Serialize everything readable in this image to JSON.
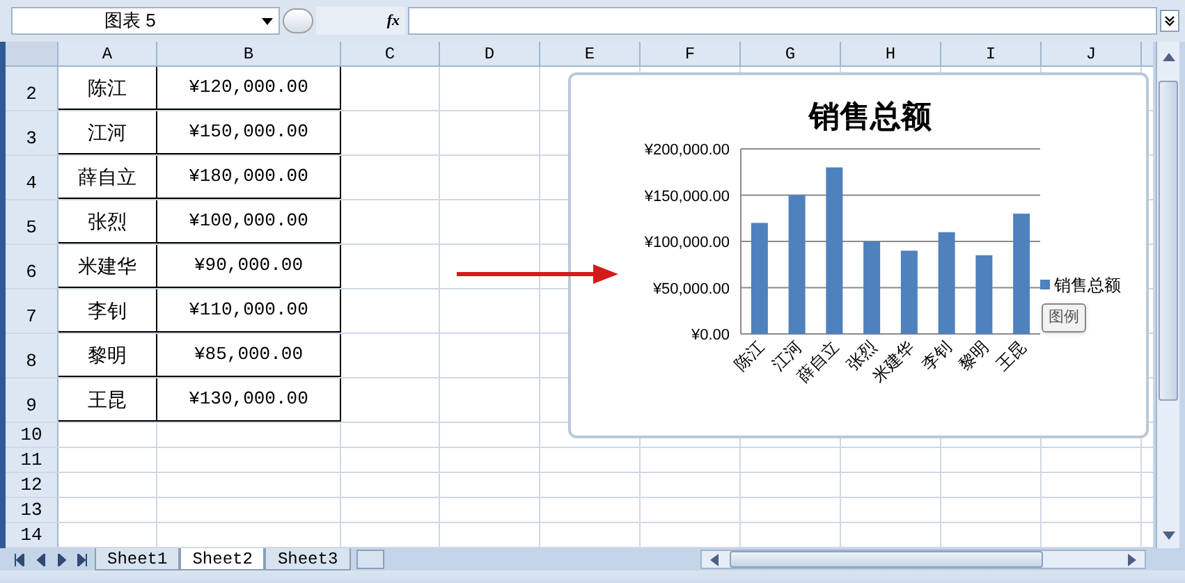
{
  "formula_bar": {
    "name_box": "图表 5",
    "fx_label": "fx"
  },
  "columns": [
    "A",
    "B",
    "C",
    "D",
    "E",
    "F",
    "G",
    "H",
    "I",
    "J"
  ],
  "rows": [
    {
      "number": "2",
      "name": "陈江",
      "amount": "¥120,000.00"
    },
    {
      "number": "3",
      "name": "江河",
      "amount": "¥150,000.00"
    },
    {
      "number": "4",
      "name": "薛自立",
      "amount": "¥180,000.00"
    },
    {
      "number": "5",
      "name": "张烈",
      "amount": "¥100,000.00"
    },
    {
      "number": "6",
      "name": "米建华",
      "amount": "¥90,000.00"
    },
    {
      "number": "7",
      "name": "李钊",
      "amount": "¥110,000.00"
    },
    {
      "number": "8",
      "name": "黎明",
      "amount": "¥85,000.00"
    },
    {
      "number": "9",
      "name": "王昆",
      "amount": "¥130,000.00"
    }
  ],
  "empty_rows": [
    "10",
    "11",
    "12",
    "13",
    "14"
  ],
  "sheet_tabs": [
    {
      "label": "Sheet1",
      "selected": false
    },
    {
      "label": "Sheet2",
      "selected": true
    },
    {
      "label": "Sheet3",
      "selected": false
    }
  ],
  "chart": {
    "tooltip": "图例",
    "chart_data": {
      "type": "bar",
      "title": "销售总额",
      "categories": [
        "陈江",
        "江河",
        "薛自立",
        "张烈",
        "米建华",
        "李钊",
        "黎明",
        "王昆"
      ],
      "series": [
        {
          "name": "销售总额",
          "color": "#4f81bd",
          "values": [
            120000,
            150000,
            180000,
            100000,
            90000,
            110000,
            85000,
            130000
          ]
        }
      ],
      "ylim": [
        0,
        200000
      ],
      "grid": "y",
      "yticks": [
        {
          "value": 0,
          "label": "¥0.00"
        },
        {
          "value": 50000,
          "label": "¥50,000.00"
        },
        {
          "value": 100000,
          "label": "¥100,000.00"
        },
        {
          "value": 150000,
          "label": "¥150,000.00"
        },
        {
          "value": 200000,
          "label": "¥200,000.00"
        }
      ]
    }
  }
}
